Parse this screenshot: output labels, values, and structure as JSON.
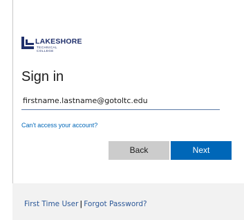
{
  "brand": {
    "logo_main": "LAKESHORE",
    "logo_sub_1": "TECHNICAL",
    "logo_sub_2": "COLLEGE",
    "color": "#1f2f6b"
  },
  "signin": {
    "title": "Sign in",
    "email_value": "firstname.lastname@gotoltc.edu",
    "cant_access": "Can't access your account?"
  },
  "buttons": {
    "back": "Back",
    "next": "Next",
    "next_color": "#0067b8"
  },
  "footer": {
    "first_time_user": "First Time User",
    "separator": "|",
    "forgot_password": "Forgot Password?"
  }
}
